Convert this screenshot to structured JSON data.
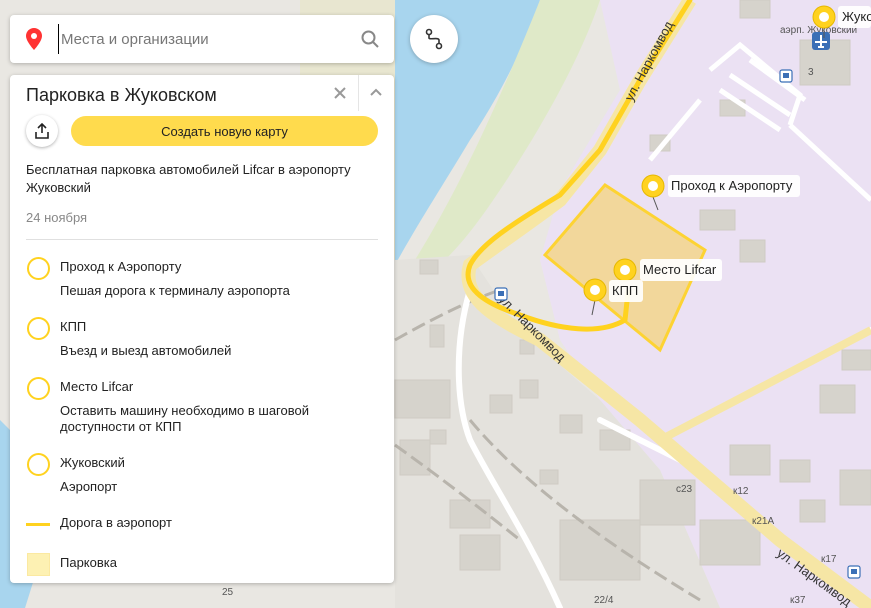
{
  "search": {
    "placeholder": "Места и организации"
  },
  "panel": {
    "title": "Парковка в Жуковском",
    "create_label": "Создать новую карту",
    "description": "Бесплатная парковка автомобилей Lifcar в аэропорту Жуковский",
    "date": "24 ноября",
    "items": [
      {
        "name": "Проход к Аэропорту",
        "sub": "Пешая дорога к терминалу аэропорта"
      },
      {
        "name": "КПП",
        "sub": "Въезд и выезд автомобилей"
      },
      {
        "name": "Место Lifcar",
        "sub": "Оставить машину необходимо в шаговой доступности от КПП"
      },
      {
        "name": "Жуковский",
        "sub": "Аэропорт"
      },
      {
        "name": "Дорога в аэропорт",
        "sub": ""
      },
      {
        "name": "Парковка",
        "sub": ""
      }
    ]
  },
  "map": {
    "markers": [
      {
        "label": "Проход к Аэропорту"
      },
      {
        "label": "Место Lifcar"
      },
      {
        "label": "КПП"
      },
      {
        "label": "Жуко"
      }
    ],
    "street_labels": [
      "ул. Наркомвод",
      "ул. Наркомвод",
      "ул. Наркомвод",
      "аэрп. Жуковский"
    ],
    "house_numbers": [
      "3",
      "с23",
      "к12",
      "к21А",
      "к17",
      "к37",
      "22/4",
      "25"
    ],
    "colors": {
      "water": "#a8d5ee",
      "airport_zone": "#ebe1f3",
      "parking_area": "#f3d792",
      "route": "#ffd21f",
      "marker": "#ffd21f"
    }
  }
}
